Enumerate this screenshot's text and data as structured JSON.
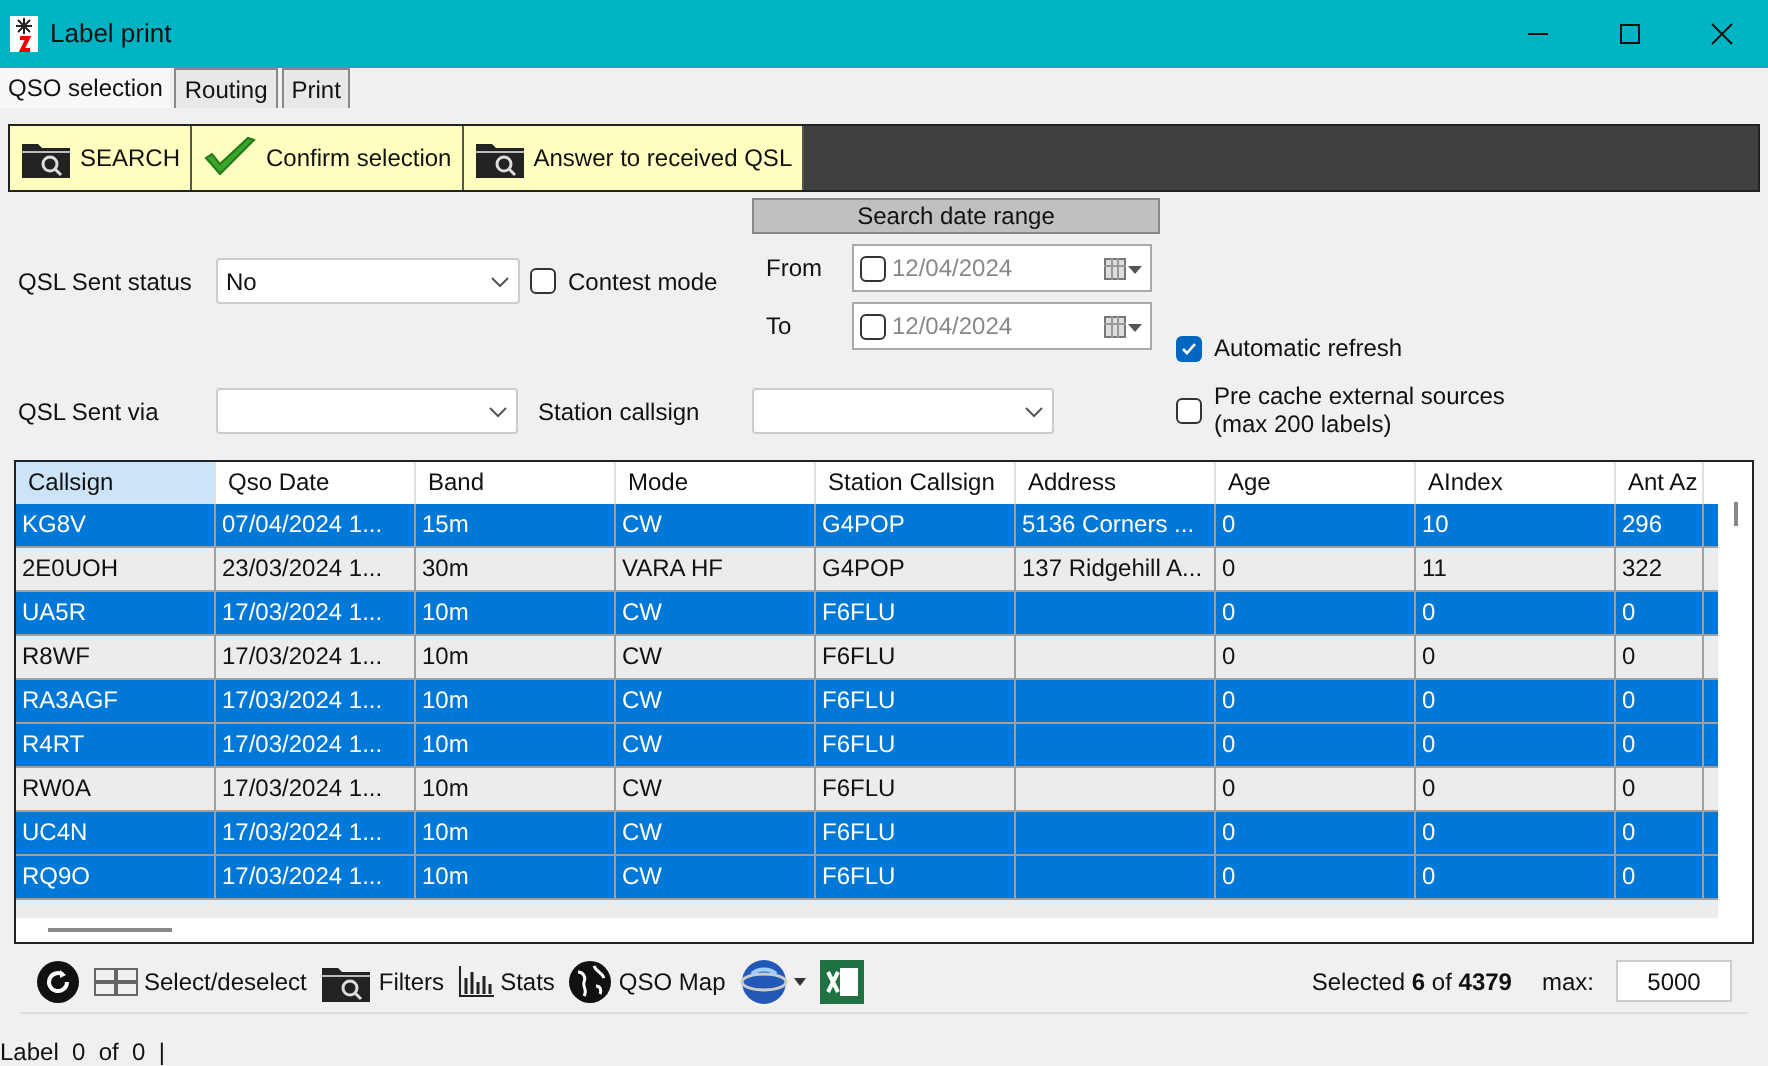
{
  "window": {
    "title": "Label print"
  },
  "tabs": [
    {
      "label": "QSO selection",
      "selected": true
    },
    {
      "label": "Routing",
      "selected": false
    },
    {
      "label": "Print",
      "selected": false
    }
  ],
  "toolbar": [
    {
      "label": "SEARCH",
      "kind": "folder"
    },
    {
      "label": "Confirm selection",
      "kind": "check"
    },
    {
      "label": "Answer to received QSL",
      "kind": "folder"
    }
  ],
  "form": {
    "qsl_sent_status": {
      "label": "QSL Sent status",
      "value": "No"
    },
    "contest_mode": {
      "label": "Contest mode",
      "checked": false
    },
    "date_range": {
      "title": "Search date range",
      "from": {
        "label": "From",
        "value": "12/04/2024",
        "checked": false
      },
      "to": {
        "label": "To",
        "value": "12/04/2024",
        "checked": false
      }
    },
    "automatic_refresh": {
      "label": "Automatic refresh",
      "checked": true
    },
    "qsl_sent_via": {
      "label": "QSL Sent via"
    },
    "station_callsign": {
      "label": "Station callsign"
    },
    "pre_cache": {
      "label": "Pre cache external sources",
      "note": "(max 200 labels)",
      "checked": false
    }
  },
  "table": {
    "columns": [
      {
        "label": "Callsign",
        "selected": true
      },
      {
        "label": "Qso Date",
        "selected": false
      },
      {
        "label": "Band",
        "selected": false
      },
      {
        "label": "Mode",
        "selected": false
      },
      {
        "label": "Station Callsign",
        "selected": false
      },
      {
        "label": "Address",
        "selected": false
      },
      {
        "label": "Age",
        "selected": false
      },
      {
        "label": "AIndex",
        "selected": false
      },
      {
        "label": "Ant Az",
        "selected": false
      }
    ],
    "rows": [
      {
        "selected": true,
        "cells": [
          "KG8V",
          "07/04/2024 1...",
          "15m",
          "CW",
          "G4POP",
          "5136 Corners ...",
          "0",
          "10",
          "296"
        ]
      },
      {
        "selected": false,
        "cells": [
          "2E0UOH",
          "23/03/2024 1...",
          "30m",
          "VARA HF",
          "G4POP",
          "137 Ridgehill A...",
          "0",
          "11",
          "322"
        ]
      },
      {
        "selected": true,
        "cells": [
          "UA5R",
          "17/03/2024 1...",
          "10m",
          "CW",
          "F6FLU",
          "",
          "0",
          "0",
          "0"
        ]
      },
      {
        "selected": false,
        "cells": [
          "R8WF",
          "17/03/2024 1...",
          "10m",
          "CW",
          "F6FLU",
          "",
          "0",
          "0",
          "0"
        ]
      },
      {
        "selected": true,
        "cells": [
          "RA3AGF",
          "17/03/2024 1...",
          "10m",
          "CW",
          "F6FLU",
          "",
          "0",
          "0",
          "0"
        ]
      },
      {
        "selected": true,
        "cells": [
          "R4RT",
          "17/03/2024 1...",
          "10m",
          "CW",
          "F6FLU",
          "",
          "0",
          "0",
          "0"
        ]
      },
      {
        "selected": false,
        "cells": [
          "RW0A",
          "17/03/2024 1...",
          "10m",
          "CW",
          "F6FLU",
          "",
          "0",
          "0",
          "0"
        ]
      },
      {
        "selected": true,
        "cells": [
          "UC4N",
          "17/03/2024 1...",
          "10m",
          "CW",
          "F6FLU",
          "",
          "0",
          "0",
          "0"
        ]
      },
      {
        "selected": true,
        "cells": [
          "RQ9O",
          "17/03/2024 1...",
          "10m",
          "CW",
          "F6FLU",
          "",
          "0",
          "0",
          "0"
        ]
      }
    ]
  },
  "bottom_toolbar": {
    "items": [
      {
        "kind": "refresh"
      },
      {
        "kind": "grid",
        "label": "Select/deselect"
      },
      {
        "kind": "folder",
        "label": "Filters"
      },
      {
        "kind": "chart",
        "label": "Stats"
      },
      {
        "kind": "globe",
        "label": "QSO Map"
      },
      {
        "kind": "earth"
      },
      {
        "kind": "excel"
      }
    ],
    "selected": "Selected **6** of **4379**",
    "max_label": "max:",
    "max_value": "5000"
  },
  "status_bar": {
    "text": "Label  0  of  0  |"
  }
}
